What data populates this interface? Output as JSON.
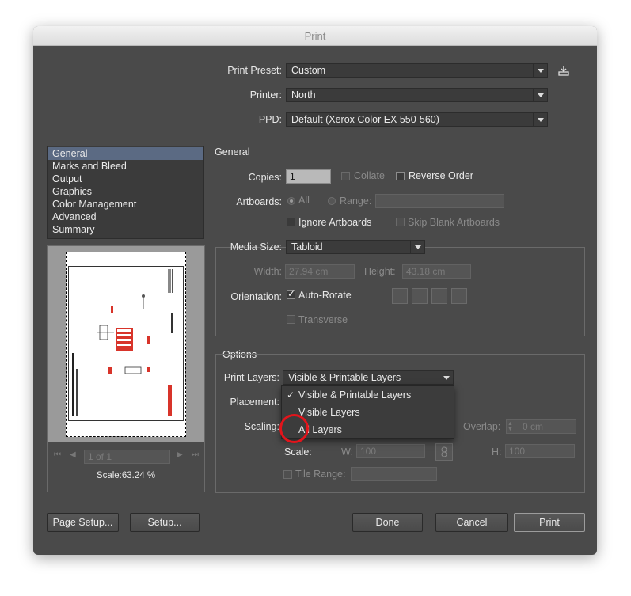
{
  "window": {
    "title": "Print"
  },
  "preset": {
    "print_preset_label": "Print Preset:",
    "print_preset_value": "Custom",
    "printer_label": "Printer:",
    "printer_value": "North",
    "ppd_label": "PPD:",
    "ppd_value": "Default (Xerox Color EX 550-560)"
  },
  "sidebar": {
    "items": [
      {
        "label": "General"
      },
      {
        "label": "Marks and Bleed"
      },
      {
        "label": "Output"
      },
      {
        "label": "Graphics"
      },
      {
        "label": "Color Management"
      },
      {
        "label": "Advanced"
      },
      {
        "label": "Summary"
      }
    ]
  },
  "preview": {
    "page_value": "1 of 1",
    "scale_text": "Scale:63.24 %"
  },
  "general": {
    "heading": "General",
    "copies_label": "Copies:",
    "copies_value": "1",
    "collate_label": "Collate",
    "reverse_order_label": "Reverse Order",
    "artboards_label": "Artboards:",
    "all_label": "All",
    "range_label": "Range:",
    "ignore_artboards_label": "Ignore Artboards",
    "skip_blank_label": "Skip Blank Artboards"
  },
  "media": {
    "media_size_label": "Media Size:",
    "media_size_value": "Tabloid",
    "width_label": "Width:",
    "width_value": "27.94 cm",
    "height_label": "Height:",
    "height_value": "43.18 cm",
    "orientation_label": "Orientation:",
    "auto_rotate_label": "Auto-Rotate",
    "transverse_label": "Transverse"
  },
  "options": {
    "heading": "Options",
    "print_layers_label": "Print Layers:",
    "print_layers_value": "Visible & Printable Layers",
    "placement_label": "Placement:",
    "scaling_label": "Scaling:",
    "overlap_label": "Overlap:",
    "overlap_value": "0 cm",
    "scale_label": "Scale:",
    "w_label": "W:",
    "w_value": "100",
    "h_label": "H:",
    "h_value": "100",
    "tile_range_label": "Tile Range:",
    "layers_menu": [
      {
        "label": "Visible & Printable Layers",
        "checked": true
      },
      {
        "label": "Visible Layers",
        "checked": false
      },
      {
        "label": "All Layers",
        "checked": false
      }
    ]
  },
  "buttons": {
    "page_setup": "Page Setup...",
    "setup": "Setup...",
    "done": "Done",
    "cancel": "Cancel",
    "print": "Print"
  },
  "colors": {
    "selection": "#5b6a83",
    "highlight_circle": "#e2141b",
    "dialog_bg": "#4a4a4a"
  }
}
